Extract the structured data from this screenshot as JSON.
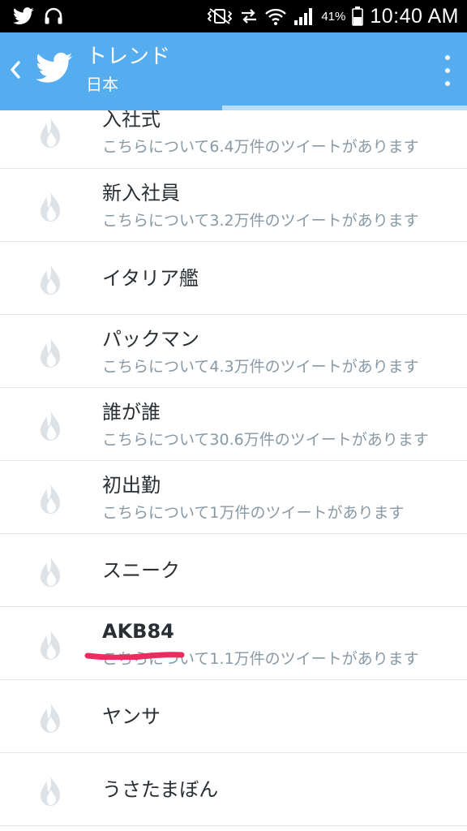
{
  "status_bar": {
    "battery_percent": "41%",
    "time": "10:40 AM",
    "icons": [
      "twitter-notification-icon",
      "headset-icon",
      "vibrate-mute-icon",
      "data-transfer-icon",
      "wifi-icon",
      "cell-signal-icon",
      "battery-icon"
    ]
  },
  "app_bar": {
    "title": "トレンド",
    "subtitle": "日本",
    "back_icon": "chevron-left-icon",
    "logo_icon": "twitter-bird-icon",
    "menu_icon": "overflow-menu-icon",
    "background_color": "#55acee"
  },
  "trends": [
    {
      "title": "入社式",
      "subtitle": "こちらについて6.4万件のツイートがあります"
    },
    {
      "title": "新入社員",
      "subtitle": "こちらについて3.2万件のツイートがあります"
    },
    {
      "title": "イタリア艦",
      "subtitle": ""
    },
    {
      "title": "パックマン",
      "subtitle": "こちらについて4.3万件のツイートがあります"
    },
    {
      "title": "誰が誰",
      "subtitle": "こちらについて30.6万件のツイートがあります"
    },
    {
      "title": "初出勤",
      "subtitle": "こちらについて1万件のツイートがあります"
    },
    {
      "title": "スニーク",
      "subtitle": ""
    },
    {
      "title": "AKB84",
      "subtitle": "こちらについて1.1万件のツイートがあります",
      "highlighted": true
    },
    {
      "title": "ヤンサ",
      "subtitle": ""
    },
    {
      "title": "うさたまぼん",
      "subtitle": ""
    }
  ],
  "trend_icon": "flame-icon",
  "annotation_color": "#ec2c5e"
}
